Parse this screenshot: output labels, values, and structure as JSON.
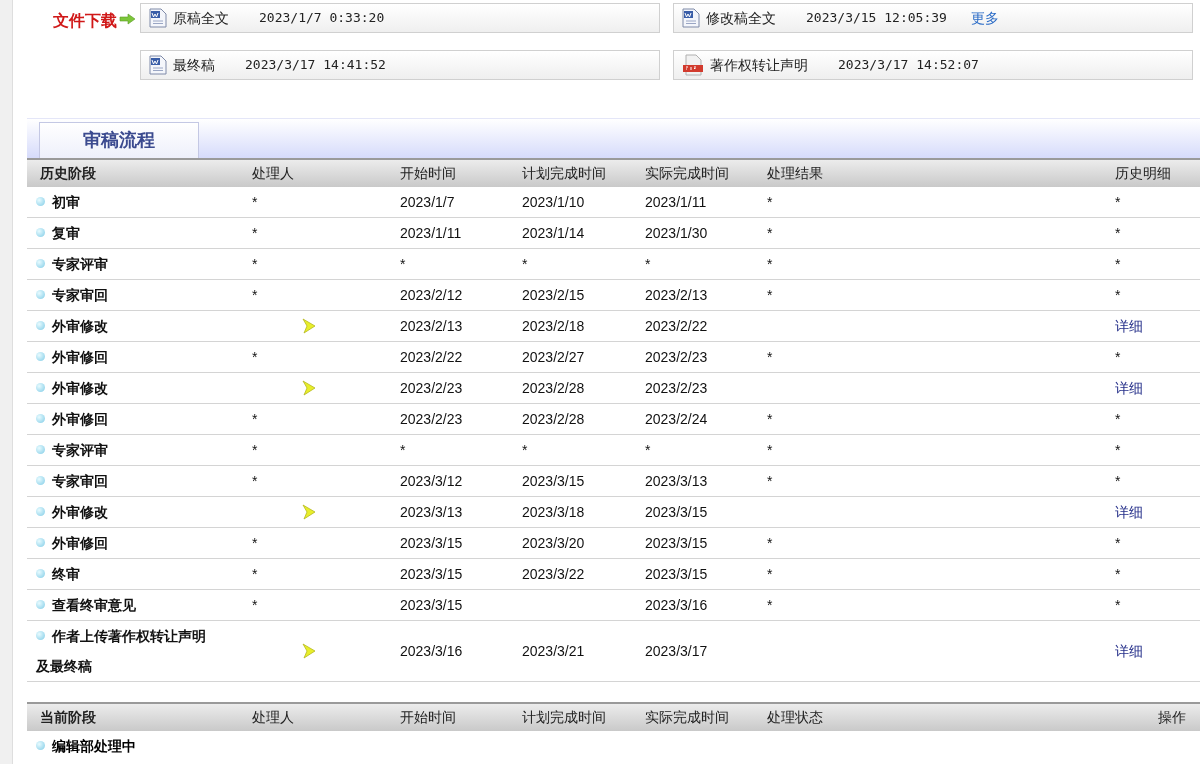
{
  "downloads": {
    "label": "文件下载",
    "files": [
      {
        "kind": "word",
        "name": "原稿全文",
        "time": "2023/1/7 0:33:20"
      },
      {
        "kind": "word",
        "name": "修改稿全文",
        "time": "2023/3/15 12:05:39",
        "link": "更多"
      },
      {
        "kind": "word",
        "name": "最终稿",
        "time": "2023/3/17 14:41:52"
      },
      {
        "kind": "pdf",
        "name": "著作权转让声明",
        "time": "2023/3/17 14:52:07"
      }
    ]
  },
  "tab": {
    "label": "审稿流程"
  },
  "history": {
    "columns": [
      "历史阶段",
      "处理人",
      "开始时间",
      "计划完成时间",
      "实际完成时间",
      "处理结果",
      "历史明细"
    ],
    "rows": [
      {
        "stage": "初审",
        "handler": {
          "kind": "text",
          "text": "*"
        },
        "start": "2023/1/7",
        "planned": "2023/1/10",
        "actual": "2023/1/11",
        "result": "*",
        "detail": {
          "kind": "text",
          "text": "*"
        }
      },
      {
        "stage": "复审",
        "handler": {
          "kind": "text",
          "text": "*"
        },
        "start": "2023/1/11",
        "planned": "2023/1/14",
        "actual": "2023/1/30",
        "result": "*",
        "detail": {
          "kind": "text",
          "text": "*"
        }
      },
      {
        "stage": "专家评审",
        "handler": {
          "kind": "text",
          "text": "*"
        },
        "start": "*",
        "planned": "*",
        "actual": "*",
        "result": "*",
        "detail": {
          "kind": "text",
          "text": "*"
        }
      },
      {
        "stage": "专家审回",
        "handler": {
          "kind": "text",
          "text": "*"
        },
        "start": "2023/2/12",
        "planned": "2023/2/15",
        "actual": "2023/2/13",
        "result": "*",
        "detail": {
          "kind": "text",
          "text": "*"
        }
      },
      {
        "stage": "外审修改",
        "handler": {
          "kind": "icon"
        },
        "start": "2023/2/13",
        "planned": "2023/2/18",
        "actual": "2023/2/22",
        "detail": {
          "kind": "link",
          "text": "详细"
        }
      },
      {
        "stage": "外审修回",
        "handler": {
          "kind": "text",
          "text": "*"
        },
        "start": "2023/2/22",
        "planned": "2023/2/27",
        "actual": "2023/2/23",
        "result": "*",
        "detail": {
          "kind": "text",
          "text": "*"
        }
      },
      {
        "stage": "外审修改",
        "handler": {
          "kind": "icon"
        },
        "start": "2023/2/23",
        "planned": "2023/2/28",
        "actual": "2023/2/23",
        "detail": {
          "kind": "link",
          "text": "详细"
        }
      },
      {
        "stage": "外审修回",
        "handler": {
          "kind": "text",
          "text": "*"
        },
        "start": "2023/2/23",
        "planned": "2023/2/28",
        "actual": "2023/2/24",
        "result": "*",
        "detail": {
          "kind": "text",
          "text": "*"
        }
      },
      {
        "stage": "专家评审",
        "handler": {
          "kind": "text",
          "text": "*"
        },
        "start": "*",
        "planned": "*",
        "actual": "*",
        "result": "*",
        "detail": {
          "kind": "text",
          "text": "*"
        }
      },
      {
        "stage": "专家审回",
        "handler": {
          "kind": "text",
          "text": "*"
        },
        "start": "2023/3/12",
        "planned": "2023/3/15",
        "actual": "2023/3/13",
        "result": "*",
        "detail": {
          "kind": "text",
          "text": "*"
        }
      },
      {
        "stage": "外审修改",
        "handler": {
          "kind": "icon"
        },
        "start": "2023/3/13",
        "planned": "2023/3/18",
        "actual": "2023/3/15",
        "detail": {
          "kind": "link",
          "text": "详细"
        }
      },
      {
        "stage": "外审修回",
        "handler": {
          "kind": "text",
          "text": "*"
        },
        "start": "2023/3/15",
        "planned": "2023/3/20",
        "actual": "2023/3/15",
        "result": "*",
        "detail": {
          "kind": "text",
          "text": "*"
        }
      },
      {
        "stage": "终审",
        "handler": {
          "kind": "text",
          "text": "*"
        },
        "start": "2023/3/15",
        "planned": "2023/3/22",
        "actual": "2023/3/15",
        "result": "*",
        "detail": {
          "kind": "text",
          "text": "*"
        }
      },
      {
        "stage": "查看终审意见",
        "handler": {
          "kind": "text",
          "text": "*"
        },
        "start": "2023/3/15",
        "actual": "2023/3/16",
        "result": "*",
        "detail": {
          "kind": "text",
          "text": "*"
        }
      },
      {
        "stage": "作者上传著作权转让声明及最终稿",
        "handler": {
          "kind": "icon"
        },
        "start": "2023/3/16",
        "planned": "2023/3/21",
        "actual": "2023/3/17",
        "detail": {
          "kind": "link",
          "text": "详细"
        }
      }
    ]
  },
  "current": {
    "columns": [
      "当前阶段",
      "处理人",
      "开始时间",
      "计划完成时间",
      "实际完成时间",
      "处理状态",
      "操作"
    ],
    "rows": [
      {
        "stage": "编辑部处理中"
      }
    ]
  }
}
